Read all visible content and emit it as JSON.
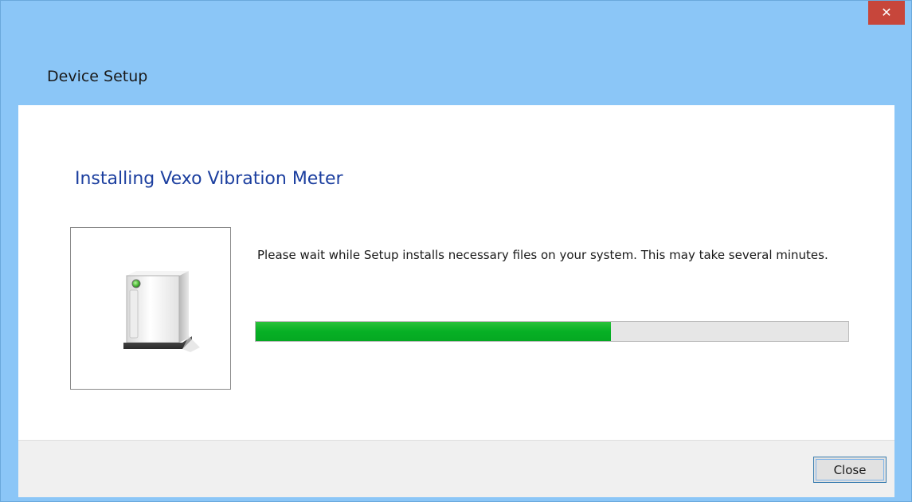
{
  "window": {
    "close_glyph": "✕",
    "title": "Device Setup"
  },
  "main": {
    "heading": "Installing Vexo Vibration Meter",
    "device_icon": "external-drive-icon",
    "message": "Please wait while Setup installs necessary files on your system. This may take several minutes.",
    "progress_fraction": 0.6
  },
  "footer": {
    "close_label": "Close"
  },
  "colors": {
    "frame": "#8bc6f7",
    "heading": "#1c3f9f",
    "progress_fill": "#06b025",
    "close_hover": "#c7463b"
  }
}
